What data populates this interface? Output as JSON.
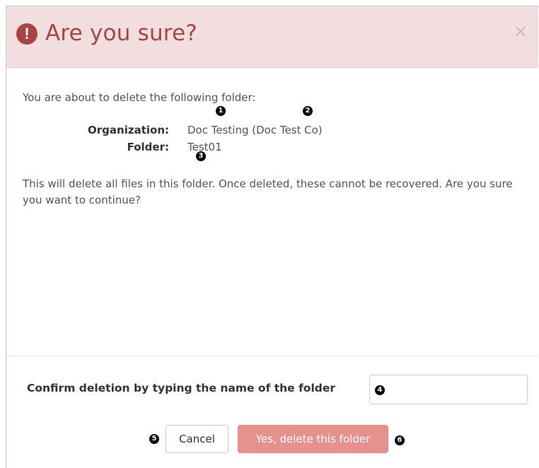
{
  "dialog": {
    "title": "Are you sure?",
    "alert_icon_glyph": "!",
    "close_glyph": "×",
    "intro": "You are about to delete the following folder:",
    "details": {
      "organization_label": "Organization:",
      "organization_value": "Doc Testing (Doc Test Co)",
      "folder_label": "Folder:",
      "folder_value": "Test01"
    },
    "warning": "This will delete all files in this folder. Once deleted, these cannot be recovered. Are you sure you want to continue?",
    "confirm": {
      "label": "Confirm deletion by typing the name of the folder",
      "value": "",
      "placeholder": ""
    },
    "buttons": {
      "cancel": "Cancel",
      "delete": "Yes, delete this folder"
    }
  },
  "annotations": [
    "1",
    "2",
    "3",
    "4",
    "5",
    "6"
  ],
  "colors": {
    "header_bg": "#f2dedf",
    "danger": "#a94442",
    "delete_button": "#e6918e"
  },
  "icons": {
    "alert": "exclamation-circle-icon",
    "close": "close-icon"
  }
}
